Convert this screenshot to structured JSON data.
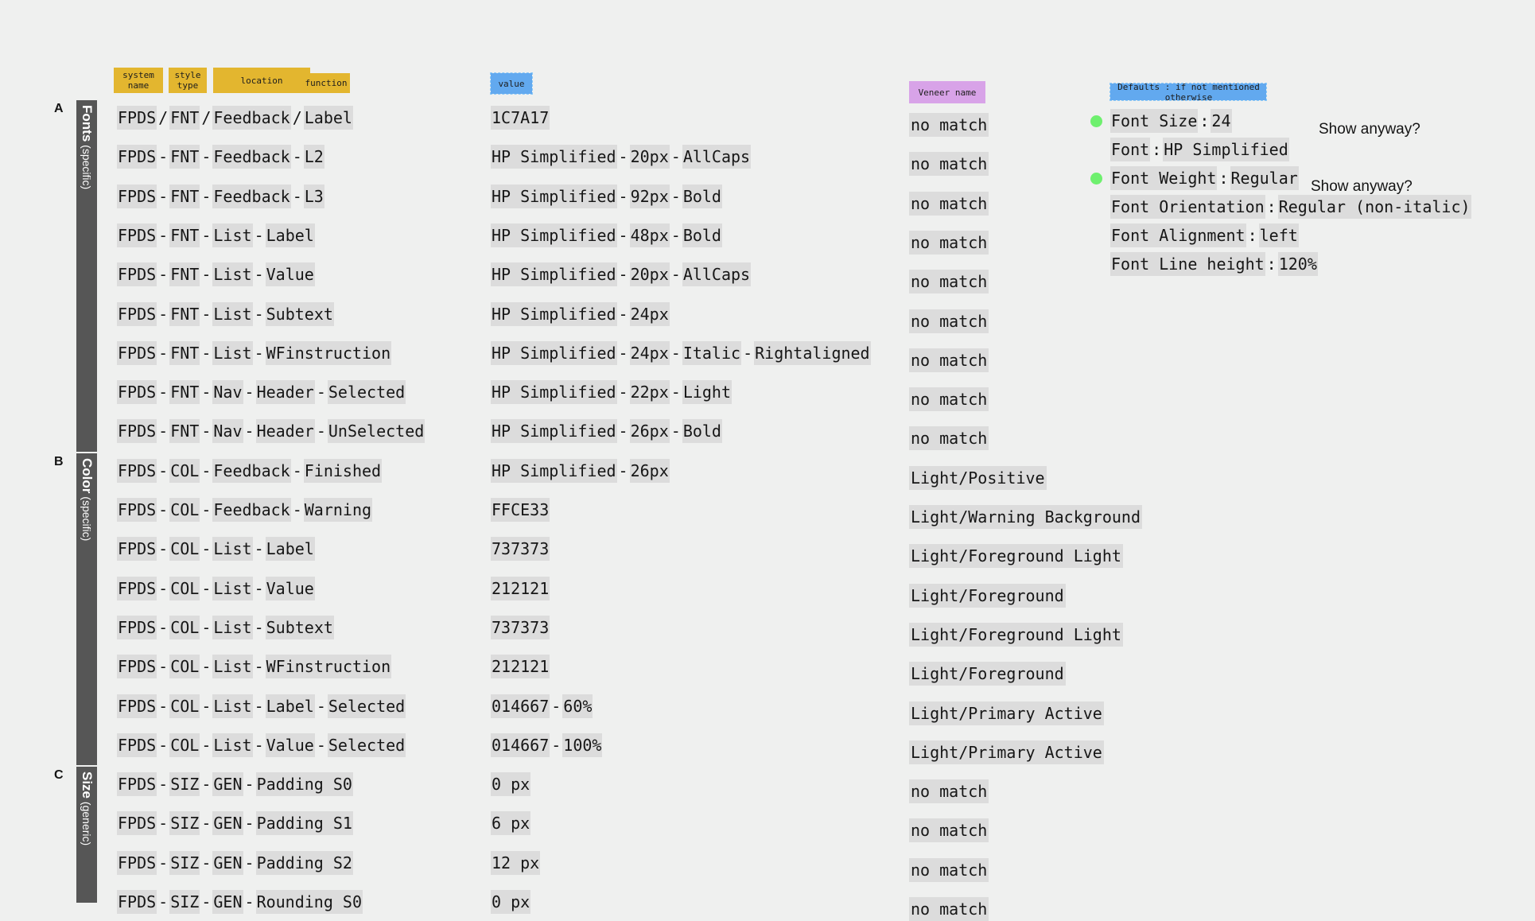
{
  "page": {
    "background": "#eff0ef",
    "segment_bg": "#dcdcdc",
    "rail_bg": "#565656"
  },
  "column_headers": [
    {
      "label": "system\nname",
      "color": "#e3b62f",
      "name": "header-tag-system-name"
    },
    {
      "label": "style\ntype",
      "color": "#e3b62f",
      "name": "header-tag-style-type"
    },
    {
      "label": "location",
      "color": "#e3b62f",
      "name": "header-tag-location"
    },
    {
      "label": "function",
      "color": "#e3b62f",
      "name": "header-tag-function"
    },
    {
      "label": "value",
      "color": "#62a9ef",
      "name": "header-tag-value",
      "selected": true
    },
    {
      "label": "Veneer name",
      "color": "#d8a3e8",
      "name": "header-tag-veneer-name"
    },
    {
      "label": "Defaults : if not mentioned otherwise",
      "color": "#62a9ef",
      "name": "header-tag-defaults",
      "selected": true
    }
  ],
  "groups": [
    {
      "letter": "A",
      "title": "Fonts",
      "qualifier": "(specific)"
    },
    {
      "letter": "B",
      "title": "Color",
      "qualifier": "(specific)"
    },
    {
      "letter": "C",
      "title": "Size",
      "qualifier": "(generic)"
    }
  ],
  "rows": [
    {
      "group": "A",
      "separator": "/",
      "name_parts": [
        "FPDS",
        "FNT",
        "Feedback",
        "Label"
      ],
      "value_parts": [
        "1C7A17"
      ],
      "veneer": "no match"
    },
    {
      "group": "A",
      "separator": "-",
      "name_parts": [
        "FPDS",
        "FNT",
        "Feedback",
        " L2"
      ],
      "value_parts": [
        "HP Simplified",
        "20px",
        "AllCaps"
      ],
      "veneer": "no match"
    },
    {
      "group": "A",
      "separator": "-",
      "name_parts": [
        "FPDS",
        "FNT",
        "Feedback",
        " L3"
      ],
      "value_parts": [
        "HP Simplified",
        "92px",
        "Bold"
      ],
      "veneer": "no match"
    },
    {
      "group": "A",
      "separator": "-",
      "name_parts": [
        "FPDS",
        "FNT",
        "List",
        "Label"
      ],
      "value_parts": [
        "HP Simplified",
        "48px",
        "Bold"
      ],
      "veneer": "no match"
    },
    {
      "group": "A",
      "separator": "-",
      "name_parts": [
        "FPDS",
        "FNT",
        "List",
        "Value"
      ],
      "value_parts": [
        "HP Simplified",
        "20px",
        "AllCaps"
      ],
      "veneer": "no match"
    },
    {
      "group": "A",
      "separator": "-",
      "name_parts": [
        "FPDS",
        "FNT",
        "List",
        "Subtext"
      ],
      "value_parts": [
        "HP Simplified",
        "24px"
      ],
      "veneer": "no match"
    },
    {
      "group": "A",
      "separator": "-",
      "name_parts": [
        "FPDS",
        "FNT",
        "List",
        "WFinstruction"
      ],
      "value_parts": [
        "HP Simplified",
        "24px",
        "Italic",
        "Rightaligned"
      ],
      "veneer": "no match"
    },
    {
      "group": "A",
      "separator": "-",
      "name_parts": [
        "FPDS",
        "FNT",
        "Nav",
        "Header",
        "Selected"
      ],
      "value_parts": [
        "HP Simplified",
        "22px",
        "Light"
      ],
      "veneer": "no match"
    },
    {
      "group": "A",
      "separator": "-",
      "name_parts": [
        "FPDS",
        "FNT",
        "Nav",
        "Header",
        "UnSelected"
      ],
      "value_parts": [
        "HP Simplified",
        "26px",
        "Bold"
      ],
      "veneer": "no match"
    },
    {
      "group": "B",
      "separator": "-",
      "name_parts": [
        "FPDS",
        "COL",
        "Feedback",
        "Finished"
      ],
      "value_parts": [
        "HP Simplified",
        "26px"
      ],
      "veneer": "Light/Positive"
    },
    {
      "group": "B",
      "separator": "-",
      "name_parts": [
        "FPDS",
        "COL",
        "Feedback",
        "Warning"
      ],
      "value_parts": [
        "FFCE33"
      ],
      "veneer": "Light/Warning Background"
    },
    {
      "group": "B",
      "separator": "-",
      "name_parts": [
        "FPDS",
        "COL",
        "List",
        "Label"
      ],
      "value_parts": [
        "737373"
      ],
      "veneer": "Light/Foreground Light"
    },
    {
      "group": "B",
      "separator": "-",
      "name_parts": [
        "FPDS",
        "COL",
        "List",
        "Value"
      ],
      "value_parts": [
        "212121"
      ],
      "veneer": "Light/Foreground"
    },
    {
      "group": "B",
      "separator": "-",
      "name_parts": [
        "FPDS",
        "COL",
        "List",
        "Subtext"
      ],
      "value_parts": [
        "737373"
      ],
      "veneer": "Light/Foreground Light"
    },
    {
      "group": "B",
      "separator": "-",
      "name_parts": [
        "FPDS",
        "COL",
        "List",
        "WFinstruction"
      ],
      "value_parts": [
        "212121"
      ],
      "veneer": "Light/Foreground"
    },
    {
      "group": "B",
      "separator": "-",
      "name_parts": [
        "FPDS",
        "COL",
        "List",
        "Label",
        "Selected"
      ],
      "value_parts": [
        "014667",
        "60%"
      ],
      "veneer": "Light/Primary Active"
    },
    {
      "group": "B",
      "separator": "-",
      "name_parts": [
        "FPDS",
        "COL",
        "List",
        "Value",
        "Selected"
      ],
      "value_parts": [
        "014667",
        "100%"
      ],
      "veneer": "Light/Primary Active"
    },
    {
      "group": "C",
      "separator": "-",
      "name_parts": [
        "FPDS",
        "SIZ",
        "GEN",
        "Padding S0"
      ],
      "value_parts": [
        "0 px"
      ],
      "veneer": "no match"
    },
    {
      "group": "C",
      "separator": "-",
      "name_parts": [
        "FPDS",
        "SIZ",
        "GEN",
        "Padding S1"
      ],
      "value_parts": [
        "6 px"
      ],
      "veneer": "no match"
    },
    {
      "group": "C",
      "separator": "-",
      "name_parts": [
        "FPDS",
        "SIZ",
        "GEN",
        "Padding S2"
      ],
      "value_parts": [
        "12 px"
      ],
      "veneer": "no match"
    },
    {
      "group": "C",
      "separator": "-",
      "name_parts": [
        "FPDS",
        "SIZ",
        "GEN",
        "Rounding S0"
      ],
      "value_parts": [
        "0 px"
      ],
      "veneer": "no match"
    }
  ],
  "defaults": {
    "header": "Defaults : if not mentioned otherwise",
    "items": [
      {
        "label": "Font Size",
        "value": "24",
        "bullet": true,
        "bullet_color": "#6ef06e",
        "note": ""
      },
      {
        "label": "Font",
        "value": "HP Simplified",
        "bullet": false,
        "note": "Show anyway?"
      },
      {
        "label": "Font Weight",
        "value": "Regular",
        "bullet": true,
        "bullet_color": "#6ef06e",
        "note": ""
      },
      {
        "label": "Font Orientation",
        "value": "Regular (non-italic)",
        "bullet": false,
        "note": "Show anyway?"
      },
      {
        "label": "Font Alignment",
        "value": "left",
        "bullet": false,
        "note": ""
      },
      {
        "label": "Font Line height",
        "value": "120%",
        "bullet": false,
        "note": ""
      }
    ]
  }
}
